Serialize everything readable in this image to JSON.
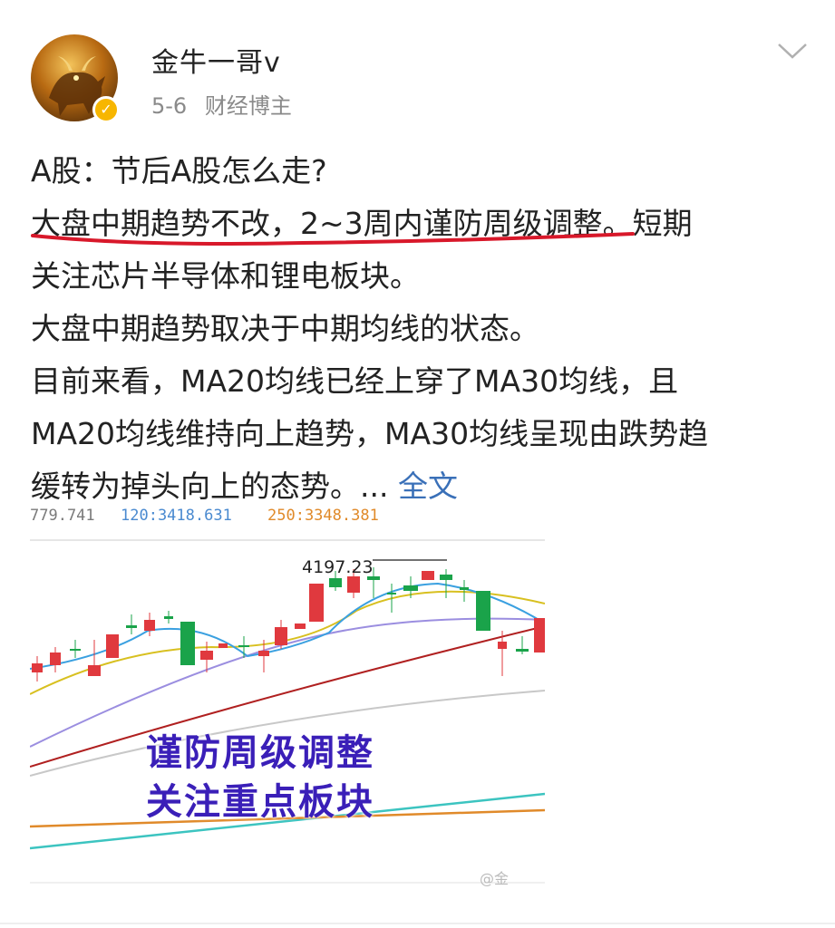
{
  "header": {
    "username": "金牛一哥v",
    "date": "5-6",
    "role": "财经博主"
  },
  "icons": {
    "avatar": "bull-avatar",
    "verified": "verified-badge-icon",
    "more": "chevron-down-icon"
  },
  "post": {
    "line1": "A股：节后A股怎么走?",
    "line2_highlight": "大盘中期趋势不改，2~3周内谨防周级调整",
    "line2_tail": "。短期",
    "line3": "关注芯片半导体和锂电板块。",
    "line4": "大盘中期趋势取决于中期均线的状态。",
    "line5": "目前来看，MA20均线已经上穿了MA30均线，且",
    "line6": "MA20均线维持向上趋势，MA30均线呈现由跌势趋",
    "line7": "缓转为掉头向上的态势。...",
    "more_link": "全文"
  },
  "colors": {
    "underline": "#d8182a",
    "link": "#3a70b8",
    "overlay_text": "#3a1fb8",
    "candle_up": "#e0393e",
    "candle_down": "#1aa34a"
  },
  "chart_image": {
    "top_labels": [
      "779.741",
      "120:3418.631",
      "250:3348.381"
    ],
    "peak_label": "4197.23",
    "overlay_line1": "谨防周级调整",
    "overlay_line2": "关注重点板块",
    "watermark": "@金"
  }
}
